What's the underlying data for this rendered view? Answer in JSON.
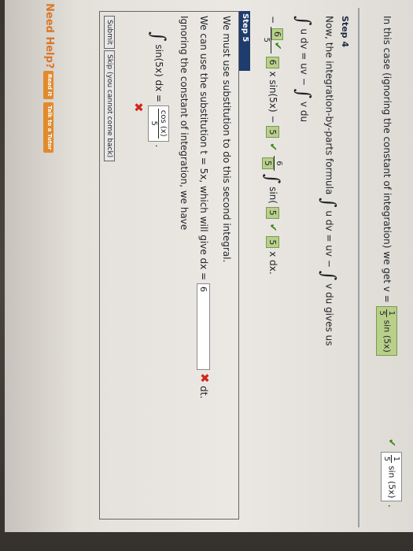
{
  "top": {
    "sentence": "In this case (ignoring the constant of integration) we get v =",
    "answer_box": {
      "num": "1",
      "den": "5",
      "func": "sin (5x)"
    },
    "result": {
      "num": "1",
      "den": "5",
      "func": "sin (5x)"
    },
    "end": "."
  },
  "step4": {
    "label": "Step 4",
    "line1_a": "Now, the integration-by-parts formula",
    "formula": "u dv = uv −",
    "formula_tail": "v du",
    "gives_us": "gives us",
    "step_formula": "u dv = uv −",
    "step_formula_tail": "v du",
    "expr_lead": "−",
    "box1": "6",
    "box1_den": "5",
    "box2": "6",
    "x_sin": "x sin(5x) −",
    "box3": "5",
    "coef_num": "6",
    "box4": "5",
    "sin_open": "sin(",
    "box5": "5",
    "box6": "5",
    "x_close": "x",
    "dx_end": "dx."
  },
  "step5": {
    "label": "Step 5",
    "line1": "We must use substitution to do this second integral.",
    "line2_a": "We can use the substitution",
    "line2_b": "t = 5x, which will give dx =",
    "dx_input": "6",
    "dt": "dt.",
    "line3": "Ignoring the constant of integration, we have",
    "int_expr": "sin(5x) dx =",
    "ans_num": "cos (x)",
    "ans_den": "5",
    "period": "."
  },
  "buttons": {
    "submit": "Submit",
    "skip": "Skip (you cannot come back)"
  },
  "help": {
    "need_help": "Need Help?",
    "read_it": "Read It",
    "talk": "Talk to a Tutor"
  }
}
